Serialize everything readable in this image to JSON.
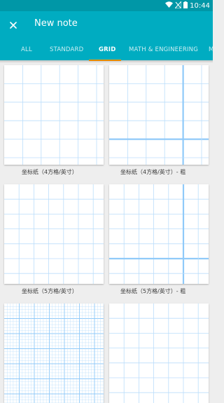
{
  "status_bar": {
    "time": "10:44",
    "icons": [
      "wifi-icon",
      "signal-off-icon",
      "battery-icon"
    ]
  },
  "app_bar": {
    "title": "New note",
    "close_icon": "close-icon"
  },
  "tabs": [
    {
      "label": "ALL",
      "active": false
    },
    {
      "label": "STANDARD",
      "active": false
    },
    {
      "label": "GRID",
      "active": true
    },
    {
      "label": "MATH & ENGINEERING",
      "active": false
    },
    {
      "label": "M",
      "active": false
    }
  ],
  "templates": [
    {
      "label": "坐标纸（4方格/英寸）",
      "grid": "4-per-inch"
    },
    {
      "label": "坐标纸（4方格/英寸）- 粗",
      "grid": "4-per-inch-bold"
    },
    {
      "label": "坐标纸（5方格/英寸）",
      "grid": "5-per-inch"
    },
    {
      "label": "坐标纸（5方格/英寸）- 粗",
      "grid": "5-per-inch-bold"
    },
    {
      "label": "",
      "grid": "fine"
    },
    {
      "label": "",
      "grid": "standard"
    }
  ],
  "colors": {
    "status_bar": "#0097a7",
    "app_bar": "#00acc1",
    "tab_indicator": "#ff9800",
    "grid_line": "#bbdefb",
    "grid_line_bold": "#90caf9"
  }
}
